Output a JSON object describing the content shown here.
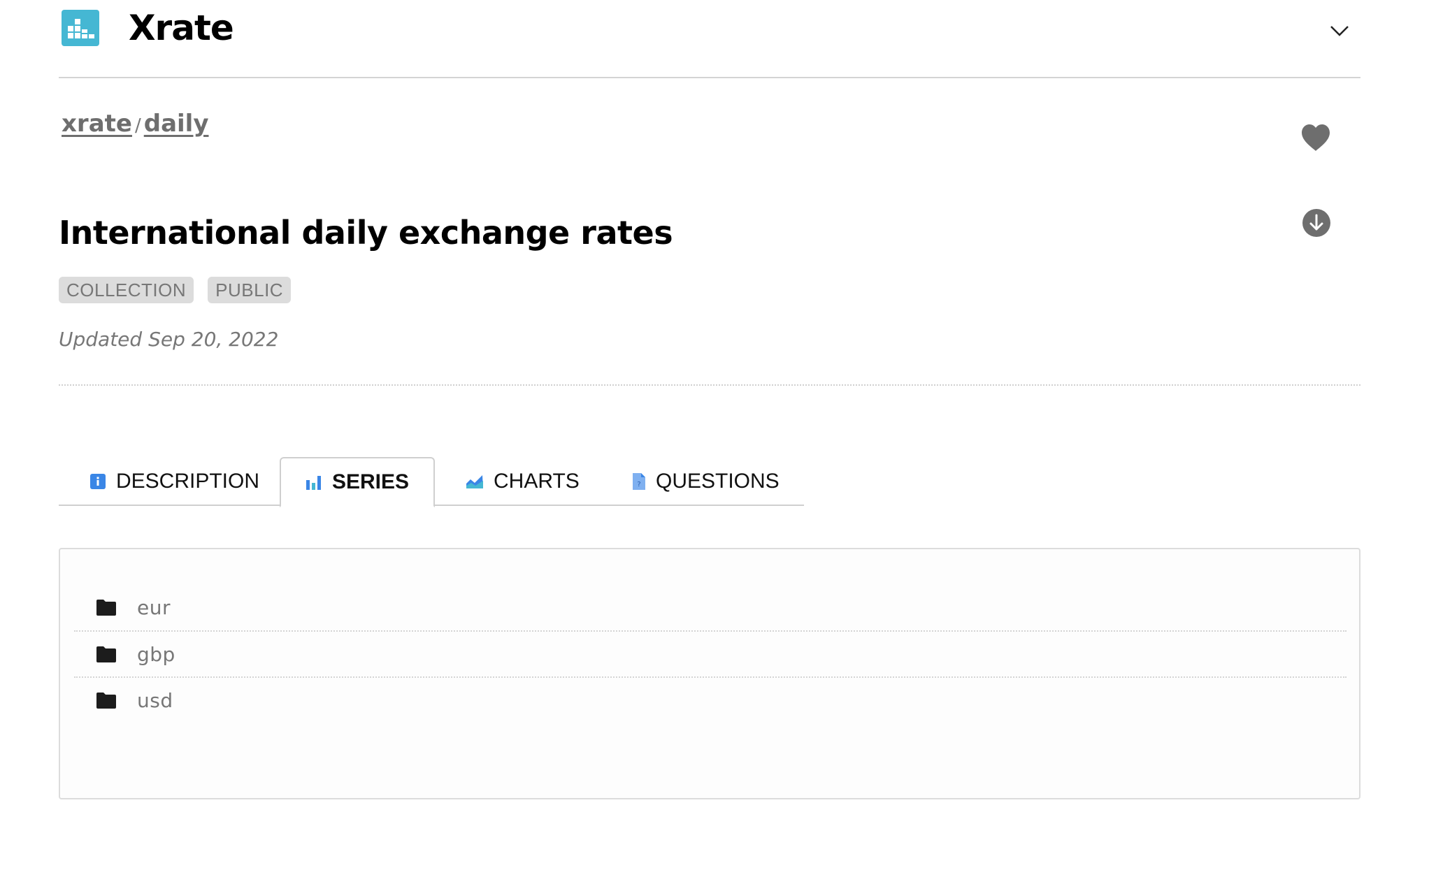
{
  "app": {
    "title": "Xrate",
    "logo_icon": "bar-chart-logo-icon",
    "menu_icon": "chevron-down-icon"
  },
  "breadcrumb": {
    "items": [
      "xrate",
      "daily"
    ],
    "separator": "/"
  },
  "actions": {
    "favorite_icon": "heart-icon",
    "download_icon": "download-icon"
  },
  "page": {
    "title": "International daily exchange rates",
    "badges": [
      "COLLECTION",
      "PUBLIC"
    ],
    "updated": "Updated Sep 20, 2022"
  },
  "tabs": [
    {
      "label": "DESCRIPTION",
      "icon": "info-icon",
      "active": false
    },
    {
      "label": "SERIES",
      "icon": "bar-chart-icon",
      "active": true
    },
    {
      "label": "CHARTS",
      "icon": "area-chart-icon",
      "active": false
    },
    {
      "label": "QUESTIONS",
      "icon": "question-document-icon",
      "active": false
    }
  ],
  "series": {
    "items": [
      "eur",
      "gbp",
      "usd"
    ],
    "item_icon": "folder-icon"
  },
  "colors": {
    "logo": "#45b7d3",
    "tab_icon_blue": "#3a86e6",
    "muted_text": "#777777",
    "badge_bg": "#dcdcdc",
    "icon_gray": "#6e6e6e"
  }
}
